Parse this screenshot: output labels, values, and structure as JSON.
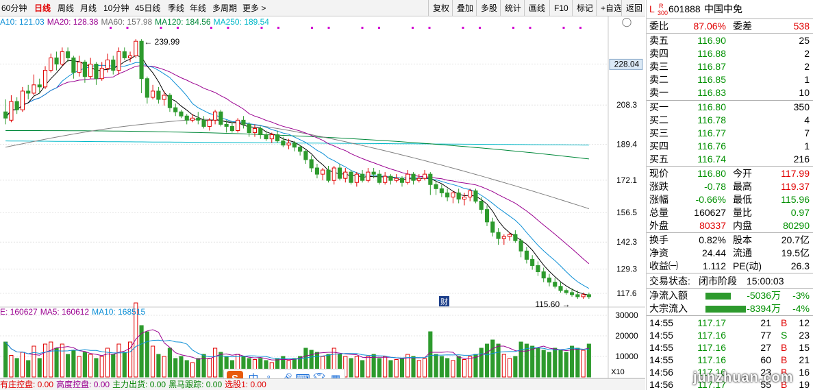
{
  "toolbar": {
    "periods": [
      "60分钟",
      "日线",
      "周线",
      "月线",
      "10分钟",
      "45日线",
      "季线",
      "年线",
      "多周期",
      "更多 >"
    ],
    "active_period": "日线",
    "buttons": [
      "复权",
      "叠加",
      "多股",
      "统计",
      "画线",
      "F10",
      "标记",
      "+自选",
      "返回"
    ]
  },
  "ma_legend": [
    {
      "label": "A10: 121.03",
      "color": "#0d8fd6"
    },
    {
      "label": "MA20: 128.38",
      "color": "#9a0090"
    },
    {
      "label": "MA60: 157.98",
      "color": "#707070"
    },
    {
      "label": "MA120: 184.56",
      "color": "#00883a"
    },
    {
      "label": "MA250: 189.54",
      "color": "#00b8c8"
    }
  ],
  "vol_legend": [
    {
      "label": "E: 160627",
      "color": "#9a0090"
    },
    {
      "label": "MA5: 160612",
      "color": "#9a0090"
    },
    {
      "label": "MA10: 168515",
      "color": "#0d8fd6"
    }
  ],
  "price_axis": [
    "228.04",
    "208.3",
    "189.4",
    "172.1",
    "156.5",
    "142.3",
    "129.3",
    "117.6"
  ],
  "volume_axis": [
    "30000",
    "20000",
    "10000",
    "X10"
  ],
  "annotations": {
    "high": "239.99",
    "low": "115.60",
    "finance_marker": "财"
  },
  "chart_data": {
    "type": "candlestick",
    "price_range": [
      113,
      245
    ],
    "candles": [
      [
        205,
        202,
        211,
        199,
        170
      ],
      [
        201,
        210,
        213,
        200,
        105
      ],
      [
        210,
        206,
        212,
        204,
        90
      ],
      [
        206,
        215,
        217,
        205,
        120
      ],
      [
        215,
        214,
        218,
        211,
        80
      ],
      [
        214,
        218,
        223,
        213,
        150
      ],
      [
        218,
        217,
        221,
        214,
        90
      ],
      [
        217,
        225,
        227,
        216,
        160
      ],
      [
        225,
        231,
        233,
        224,
        170
      ],
      [
        231,
        228,
        234,
        225,
        140
      ],
      [
        228,
        234,
        236,
        227,
        160
      ],
      [
        234,
        231,
        236,
        229,
        110
      ],
      [
        231,
        224,
        232,
        221,
        130
      ],
      [
        224,
        229,
        232,
        222,
        100
      ],
      [
        229,
        222,
        230,
        219,
        120
      ],
      [
        222,
        228,
        231,
        221,
        110
      ],
      [
        228,
        221,
        229,
        218,
        90
      ],
      [
        221,
        226,
        229,
        220,
        100
      ],
      [
        226,
        230,
        233,
        224,
        140
      ],
      [
        230,
        225,
        232,
        223,
        110
      ],
      [
        225,
        234,
        236,
        223,
        160
      ],
      [
        234,
        231,
        236,
        230,
        120
      ],
      [
        231,
        232,
        234,
        229,
        170
      ],
      [
        232,
        239,
        240,
        231,
        360
      ],
      [
        239,
        221,
        240,
        214,
        250
      ],
      [
        221,
        212,
        222,
        209,
        220
      ],
      [
        212,
        215,
        218,
        211,
        150
      ],
      [
        215,
        211,
        217,
        209,
        110
      ],
      [
        211,
        213,
        215,
        208,
        100
      ],
      [
        213,
        207,
        214,
        205,
        140
      ],
      [
        207,
        205,
        209,
        203,
        90
      ],
      [
        205,
        203,
        206,
        202,
        100
      ],
      [
        203,
        201,
        204,
        199,
        80
      ],
      [
        201,
        202,
        204,
        200,
        70
      ],
      [
        202,
        201,
        205,
        199,
        90
      ],
      [
        201,
        198,
        203,
        197,
        110
      ],
      [
        198,
        201,
        202,
        196,
        90
      ],
      [
        201,
        205,
        206,
        199,
        140
      ],
      [
        205,
        199,
        206,
        198,
        120
      ],
      [
        199,
        198,
        201,
        195,
        100
      ],
      [
        198,
        196,
        200,
        195,
        80
      ],
      [
        196,
        201,
        202,
        195,
        110
      ],
      [
        201,
        199,
        203,
        197,
        100
      ],
      [
        199,
        195,
        200,
        193,
        90
      ],
      [
        195,
        197,
        199,
        193,
        85
      ],
      [
        197,
        194,
        198,
        192,
        90
      ],
      [
        194,
        192,
        196,
        191,
        80
      ],
      [
        192,
        194,
        195,
        190,
        70
      ],
      [
        194,
        191,
        196,
        190,
        90
      ],
      [
        191,
        189,
        193,
        188,
        100
      ],
      [
        189,
        190,
        192,
        187,
        80
      ],
      [
        190,
        188,
        191,
        186,
        90
      ],
      [
        188,
        186,
        189,
        184,
        100
      ],
      [
        186,
        182,
        187,
        180,
        140
      ],
      [
        182,
        178,
        184,
        176,
        130
      ],
      [
        178,
        175,
        180,
        173,
        120
      ],
      [
        175,
        177,
        178,
        172,
        100
      ],
      [
        177,
        172,
        179,
        171,
        110
      ],
      [
        172,
        178,
        179,
        170,
        140
      ],
      [
        178,
        173,
        180,
        172,
        110
      ],
      [
        173,
        176,
        178,
        171,
        100
      ],
      [
        176,
        171,
        177,
        170,
        90
      ],
      [
        171,
        175,
        176,
        169,
        100
      ],
      [
        175,
        172,
        177,
        171,
        80
      ],
      [
        172,
        176,
        178,
        171,
        100
      ],
      [
        176,
        175,
        178,
        173,
        110
      ],
      [
        175,
        171,
        177,
        170,
        90
      ],
      [
        171,
        174,
        176,
        170,
        100
      ],
      [
        174,
        172,
        175,
        170,
        80
      ],
      [
        172,
        173,
        175,
        171,
        85
      ],
      [
        173,
        171,
        174,
        169,
        90
      ],
      [
        171,
        175,
        177,
        170,
        110
      ],
      [
        175,
        172,
        176,
        170,
        100
      ],
      [
        172,
        173,
        175,
        171,
        80
      ],
      [
        173,
        175,
        177,
        172,
        90
      ],
      [
        175,
        170,
        176,
        165,
        220
      ],
      [
        170,
        168,
        172,
        165,
        110
      ],
      [
        168,
        166,
        170,
        164,
        100
      ],
      [
        166,
        164,
        168,
        162,
        90
      ],
      [
        164,
        166,
        167,
        161,
        80
      ],
      [
        166,
        163,
        168,
        161,
        100
      ],
      [
        163,
        164,
        166,
        160,
        85
      ],
      [
        164,
        167,
        168,
        162,
        100
      ],
      [
        167,
        162,
        168,
        161,
        110
      ],
      [
        162,
        158,
        164,
        156,
        140
      ],
      [
        158,
        152,
        160,
        150,
        160
      ],
      [
        152,
        147,
        154,
        145,
        180
      ],
      [
        147,
        144,
        149,
        141,
        160
      ],
      [
        144,
        145,
        146,
        141,
        110
      ],
      [
        145,
        146,
        147,
        143,
        90
      ],
      [
        146,
        143,
        148,
        142,
        100
      ],
      [
        143,
        138,
        144,
        135,
        170
      ],
      [
        138,
        134,
        140,
        132,
        160
      ],
      [
        134,
        131,
        136,
        129,
        150
      ],
      [
        131,
        128,
        133,
        126,
        140
      ],
      [
        128,
        125,
        130,
        123,
        130
      ],
      [
        125,
        123,
        127,
        121,
        120
      ],
      [
        123,
        121,
        125,
        120,
        140
      ],
      [
        121,
        119,
        123,
        118,
        130
      ],
      [
        119,
        118,
        120,
        117,
        120
      ],
      [
        118,
        117,
        120,
        116,
        150
      ],
      [
        117,
        116,
        119,
        115,
        140
      ],
      [
        116,
        117,
        118,
        115,
        130
      ],
      [
        117,
        116,
        118,
        115,
        160
      ]
    ]
  },
  "stock": {
    "code": "601888",
    "name": "中国中免",
    "tag_l": "L",
    "tag_r": "R",
    "tag_300": "300"
  },
  "order_book": {
    "ratio_label": "委比",
    "ratio": "87.06%",
    "diff_label": "委差",
    "diff": "538",
    "asks": [
      {
        "label": "卖五",
        "price": "116.90",
        "vol": "25"
      },
      {
        "label": "卖四",
        "price": "116.88",
        "vol": "2"
      },
      {
        "label": "卖三",
        "price": "116.87",
        "vol": "2"
      },
      {
        "label": "卖二",
        "price": "116.85",
        "vol": "1"
      },
      {
        "label": "卖一",
        "price": "116.83",
        "vol": "10"
      }
    ],
    "bids": [
      {
        "label": "买一",
        "price": "116.80",
        "vol": "350"
      },
      {
        "label": "买二",
        "price": "116.78",
        "vol": "4"
      },
      {
        "label": "买三",
        "price": "116.77",
        "vol": "7"
      },
      {
        "label": "买四",
        "price": "116.76",
        "vol": "1"
      },
      {
        "label": "买五",
        "price": "116.74",
        "vol": "216"
      }
    ]
  },
  "quote": [
    {
      "l1": "现价",
      "v1": "116.80",
      "c1": "green",
      "l2": "今开",
      "v2": "117.99",
      "c2": "red"
    },
    {
      "l1": "涨跌",
      "v1": "-0.78",
      "c1": "green",
      "l2": "最高",
      "v2": "119.37",
      "c2": "red"
    },
    {
      "l1": "涨幅",
      "v1": "-0.66%",
      "c1": "green",
      "l2": "最低",
      "v2": "115.96",
      "c2": "green"
    },
    {
      "l1": "总量",
      "v1": "160627",
      "c1": "",
      "l2": "量比",
      "v2": "0.97",
      "c2": "green"
    },
    {
      "l1": "外盘",
      "v1": "80337",
      "c1": "red",
      "l2": "内盘",
      "v2": "80290",
      "c2": "green"
    }
  ],
  "fundamentals": [
    {
      "l1": "换手",
      "v1": "0.82%",
      "l2": "股本",
      "v2": "20.7亿"
    },
    {
      "l1": "净资",
      "v1": "24.44",
      "l2": "流通",
      "v2": "19.5亿"
    },
    {
      "l1": "收益㈠",
      "v1": "1.112",
      "l2": "PE(动)",
      "v2": "26.3"
    }
  ],
  "status": {
    "label": "交易状态:",
    "value": "闭市阶段",
    "time": "15:00:03"
  },
  "flows": [
    {
      "label": "净流入额",
      "value": "-5036万",
      "pct": "-3%",
      "bar": 0.6
    },
    {
      "label": "大宗流入",
      "value": "-8394万",
      "pct": "-4%",
      "bar": 0.95
    }
  ],
  "ticks": [
    {
      "time": "14:55",
      "price": "117.17",
      "vol": "21",
      "side": "B",
      "n": "12"
    },
    {
      "time": "14:55",
      "price": "117.16",
      "vol": "77",
      "side": "S",
      "n": "23"
    },
    {
      "time": "14:55",
      "price": "117.16",
      "vol": "27",
      "side": "B",
      "n": "15"
    },
    {
      "time": "14:55",
      "price": "117.16",
      "vol": "60",
      "side": "B",
      "n": "21"
    },
    {
      "time": "14:56",
      "price": "117.16",
      "vol": "23",
      "side": "B",
      "n": "16"
    },
    {
      "time": "14:56",
      "price": "117.17",
      "vol": "55",
      "side": "B",
      "n": "19"
    }
  ],
  "bottom_bar": [
    "有庄控盘: 0.00",
    "高度控盘: 0.00",
    "主力出货: 0.00",
    "黑马跟踪: 0.00",
    "选股1: 0.00"
  ],
  "ime": {
    "zh": "中",
    "punct": "°,"
  },
  "watermark": "junzhuan.com",
  "colors": {
    "up": "#e00000",
    "down": "#2d9a2d",
    "ma5": "#000000",
    "ma10": "#0d8fd6",
    "ma20": "#9a0090",
    "ma60": "#808080",
    "ma120": "#00883a",
    "ma250": "#00b8c8"
  }
}
